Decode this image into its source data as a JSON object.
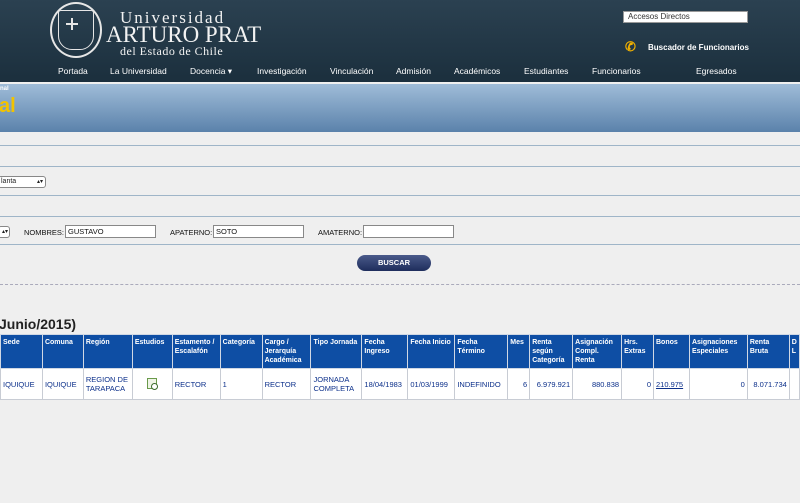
{
  "header": {
    "logo_line1": "Universidad",
    "logo_line2": "ARTURO PRAT",
    "logo_line3": "del Estado de Chile",
    "accesos": "Accesos Directos",
    "buscador": "Buscador de Funcionarios",
    "phone_icon": "phone-icon"
  },
  "nav": {
    "items": [
      "Portada",
      "La Universidad",
      "Docencia ▾",
      "Investigación",
      "Vinculación",
      "Admisión",
      "Académicos",
      "Estudiantes",
      "Funcionarios",
      "Egresados"
    ]
  },
  "banner": {
    "small_text": "nal",
    "big_text": "al"
  },
  "form": {
    "planta_select": "lanta",
    "nombres_label": "NOMBRES:",
    "nombres_value": "GUSTAVO",
    "apaterno_label": "APATERNO:",
    "apaterno_value": "SOTO",
    "amaterno_label": "AMATERNO:",
    "amaterno_value": "",
    "buscar_label": "BUSCAR"
  },
  "results": {
    "title": "Junio/2015)",
    "columns": [
      "Sede",
      "Comuna",
      "Región",
      "Estudios",
      "Estamento / Escalafón",
      "Categoría",
      "Cargo / Jerarquía Académica",
      "Tipo Jornada",
      "Fecha Ingreso",
      "Fecha Inicio",
      "Fecha Término",
      "Mes",
      "Renta según Categoría",
      "Asignación Compl. Renta",
      "Hrs. Extras",
      "Bonos",
      "Asignaciones Especiales",
      "Renta Bruta",
      "D L"
    ],
    "rows": [
      [
        "IQUIQUE",
        "IQUIQUE",
        "REGION DE TARAPACA",
        "",
        "RECTOR",
        "1",
        "RECTOR",
        "JORNADA COMPLETA",
        "18/04/1983",
        "01/03/1999",
        "INDEFINIDO",
        "6",
        "6.979.921",
        "880.838",
        "0",
        "210.975",
        "0",
        "8.071.734",
        ""
      ]
    ]
  }
}
